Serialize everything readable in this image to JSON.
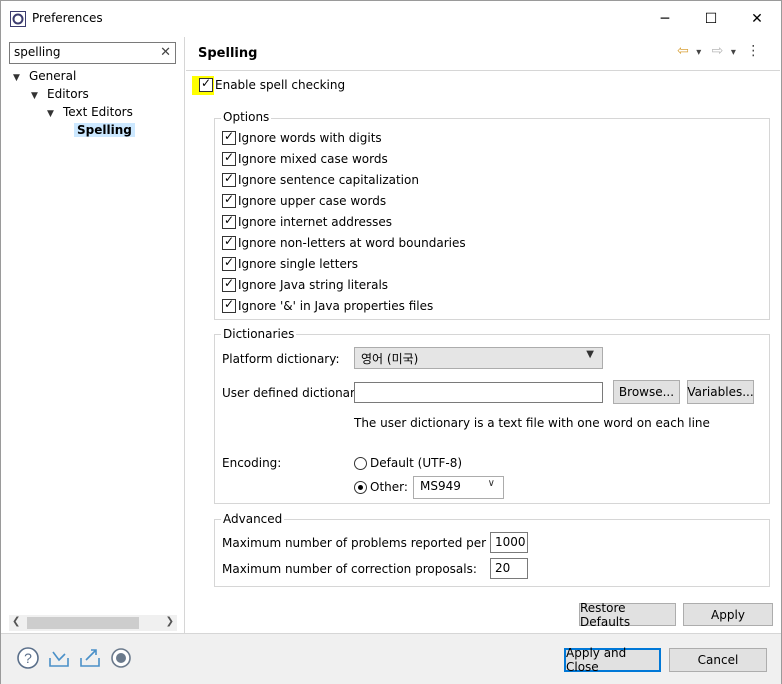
{
  "window": {
    "title": "Preferences",
    "minimize": "─",
    "maximize": "☐",
    "close": "✕"
  },
  "filter": {
    "value": "spelling",
    "clear": "✕"
  },
  "tree": {
    "general": "General",
    "editors": "Editors",
    "text_editors": "Text Editors",
    "spelling": "Spelling"
  },
  "page": {
    "title": "Spelling",
    "enable_label": "Enable spell checking",
    "nav_back": "⇦",
    "nav_forward": "⇨",
    "menu": "⋮",
    "dropdown": "▾"
  },
  "options": {
    "title": "Options",
    "items": [
      "Ignore words with digits",
      "Ignore mixed case words",
      "Ignore sentence capitalization",
      "Ignore upper case words",
      "Ignore internet addresses",
      "Ignore non-letters at word boundaries",
      "Ignore single letters",
      "Ignore Java string literals",
      "Ignore '&' in Java properties files"
    ]
  },
  "dictionaries": {
    "title": "Dictionaries",
    "platform_label": "Platform dictionary:",
    "platform_value": "영어 (미국)",
    "user_label": "User defined dictionary:",
    "user_value": "",
    "browse": "Browse...",
    "variables": "Variables...",
    "hint": "The user dictionary is a text file with one word on each line",
    "encoding_label": "Encoding:",
    "default_option": "Default (UTF-8)",
    "other_option": "Other:",
    "other_value": "MS949"
  },
  "advanced": {
    "title": "Advanced",
    "max_problems_label": "Maximum number of problems reported per file:",
    "max_problems_value": "1000",
    "max_proposals_label": "Maximum number of correction proposals:",
    "max_proposals_value": "20"
  },
  "buttons": {
    "restore_defaults": "Restore Defaults",
    "apply": "Apply",
    "apply_and_close": "Apply and Close",
    "cancel": "Cancel"
  },
  "bottom_icons": [
    "help-icon",
    "import-icon",
    "export-icon",
    "record-icon"
  ]
}
